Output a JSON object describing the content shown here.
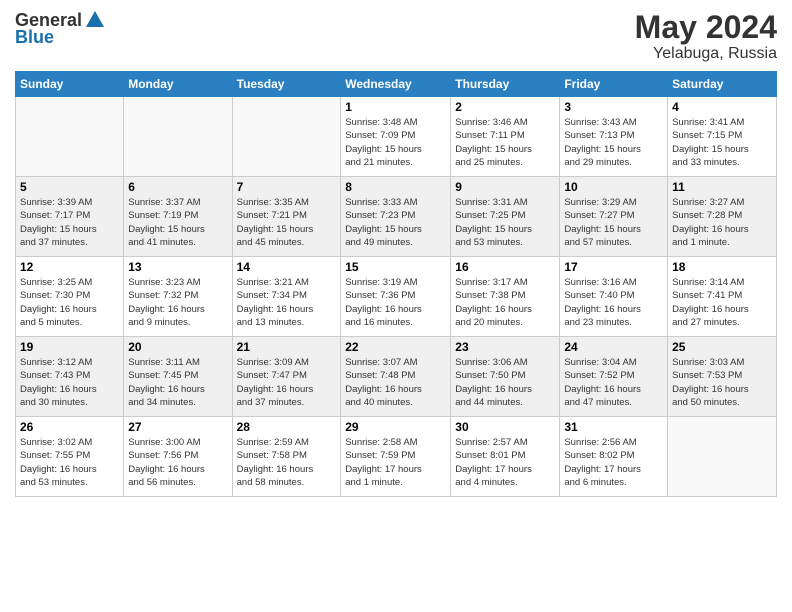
{
  "header": {
    "logo_line1": "General",
    "logo_line2": "Blue",
    "month": "May 2024",
    "location": "Yelabuga, Russia"
  },
  "days_of_week": [
    "Sunday",
    "Monday",
    "Tuesday",
    "Wednesday",
    "Thursday",
    "Friday",
    "Saturday"
  ],
  "weeks": [
    [
      {
        "day": "",
        "info": ""
      },
      {
        "day": "",
        "info": ""
      },
      {
        "day": "",
        "info": ""
      },
      {
        "day": "1",
        "info": "Sunrise: 3:48 AM\nSunset: 7:09 PM\nDaylight: 15 hours\nand 21 minutes."
      },
      {
        "day": "2",
        "info": "Sunrise: 3:46 AM\nSunset: 7:11 PM\nDaylight: 15 hours\nand 25 minutes."
      },
      {
        "day": "3",
        "info": "Sunrise: 3:43 AM\nSunset: 7:13 PM\nDaylight: 15 hours\nand 29 minutes."
      },
      {
        "day": "4",
        "info": "Sunrise: 3:41 AM\nSunset: 7:15 PM\nDaylight: 15 hours\nand 33 minutes."
      }
    ],
    [
      {
        "day": "5",
        "info": "Sunrise: 3:39 AM\nSunset: 7:17 PM\nDaylight: 15 hours\nand 37 minutes."
      },
      {
        "day": "6",
        "info": "Sunrise: 3:37 AM\nSunset: 7:19 PM\nDaylight: 15 hours\nand 41 minutes."
      },
      {
        "day": "7",
        "info": "Sunrise: 3:35 AM\nSunset: 7:21 PM\nDaylight: 15 hours\nand 45 minutes."
      },
      {
        "day": "8",
        "info": "Sunrise: 3:33 AM\nSunset: 7:23 PM\nDaylight: 15 hours\nand 49 minutes."
      },
      {
        "day": "9",
        "info": "Sunrise: 3:31 AM\nSunset: 7:25 PM\nDaylight: 15 hours\nand 53 minutes."
      },
      {
        "day": "10",
        "info": "Sunrise: 3:29 AM\nSunset: 7:27 PM\nDaylight: 15 hours\nand 57 minutes."
      },
      {
        "day": "11",
        "info": "Sunrise: 3:27 AM\nSunset: 7:28 PM\nDaylight: 16 hours\nand 1 minute."
      }
    ],
    [
      {
        "day": "12",
        "info": "Sunrise: 3:25 AM\nSunset: 7:30 PM\nDaylight: 16 hours\nand 5 minutes."
      },
      {
        "day": "13",
        "info": "Sunrise: 3:23 AM\nSunset: 7:32 PM\nDaylight: 16 hours\nand 9 minutes."
      },
      {
        "day": "14",
        "info": "Sunrise: 3:21 AM\nSunset: 7:34 PM\nDaylight: 16 hours\nand 13 minutes."
      },
      {
        "day": "15",
        "info": "Sunrise: 3:19 AM\nSunset: 7:36 PM\nDaylight: 16 hours\nand 16 minutes."
      },
      {
        "day": "16",
        "info": "Sunrise: 3:17 AM\nSunset: 7:38 PM\nDaylight: 16 hours\nand 20 minutes."
      },
      {
        "day": "17",
        "info": "Sunrise: 3:16 AM\nSunset: 7:40 PM\nDaylight: 16 hours\nand 23 minutes."
      },
      {
        "day": "18",
        "info": "Sunrise: 3:14 AM\nSunset: 7:41 PM\nDaylight: 16 hours\nand 27 minutes."
      }
    ],
    [
      {
        "day": "19",
        "info": "Sunrise: 3:12 AM\nSunset: 7:43 PM\nDaylight: 16 hours\nand 30 minutes."
      },
      {
        "day": "20",
        "info": "Sunrise: 3:11 AM\nSunset: 7:45 PM\nDaylight: 16 hours\nand 34 minutes."
      },
      {
        "day": "21",
        "info": "Sunrise: 3:09 AM\nSunset: 7:47 PM\nDaylight: 16 hours\nand 37 minutes."
      },
      {
        "day": "22",
        "info": "Sunrise: 3:07 AM\nSunset: 7:48 PM\nDaylight: 16 hours\nand 40 minutes."
      },
      {
        "day": "23",
        "info": "Sunrise: 3:06 AM\nSunset: 7:50 PM\nDaylight: 16 hours\nand 44 minutes."
      },
      {
        "day": "24",
        "info": "Sunrise: 3:04 AM\nSunset: 7:52 PM\nDaylight: 16 hours\nand 47 minutes."
      },
      {
        "day": "25",
        "info": "Sunrise: 3:03 AM\nSunset: 7:53 PM\nDaylight: 16 hours\nand 50 minutes."
      }
    ],
    [
      {
        "day": "26",
        "info": "Sunrise: 3:02 AM\nSunset: 7:55 PM\nDaylight: 16 hours\nand 53 minutes."
      },
      {
        "day": "27",
        "info": "Sunrise: 3:00 AM\nSunset: 7:56 PM\nDaylight: 16 hours\nand 56 minutes."
      },
      {
        "day": "28",
        "info": "Sunrise: 2:59 AM\nSunset: 7:58 PM\nDaylight: 16 hours\nand 58 minutes."
      },
      {
        "day": "29",
        "info": "Sunrise: 2:58 AM\nSunset: 7:59 PM\nDaylight: 17 hours\nand 1 minute."
      },
      {
        "day": "30",
        "info": "Sunrise: 2:57 AM\nSunset: 8:01 PM\nDaylight: 17 hours\nand 4 minutes."
      },
      {
        "day": "31",
        "info": "Sunrise: 2:56 AM\nSunset: 8:02 PM\nDaylight: 17 hours\nand 6 minutes."
      },
      {
        "day": "",
        "info": ""
      }
    ]
  ]
}
